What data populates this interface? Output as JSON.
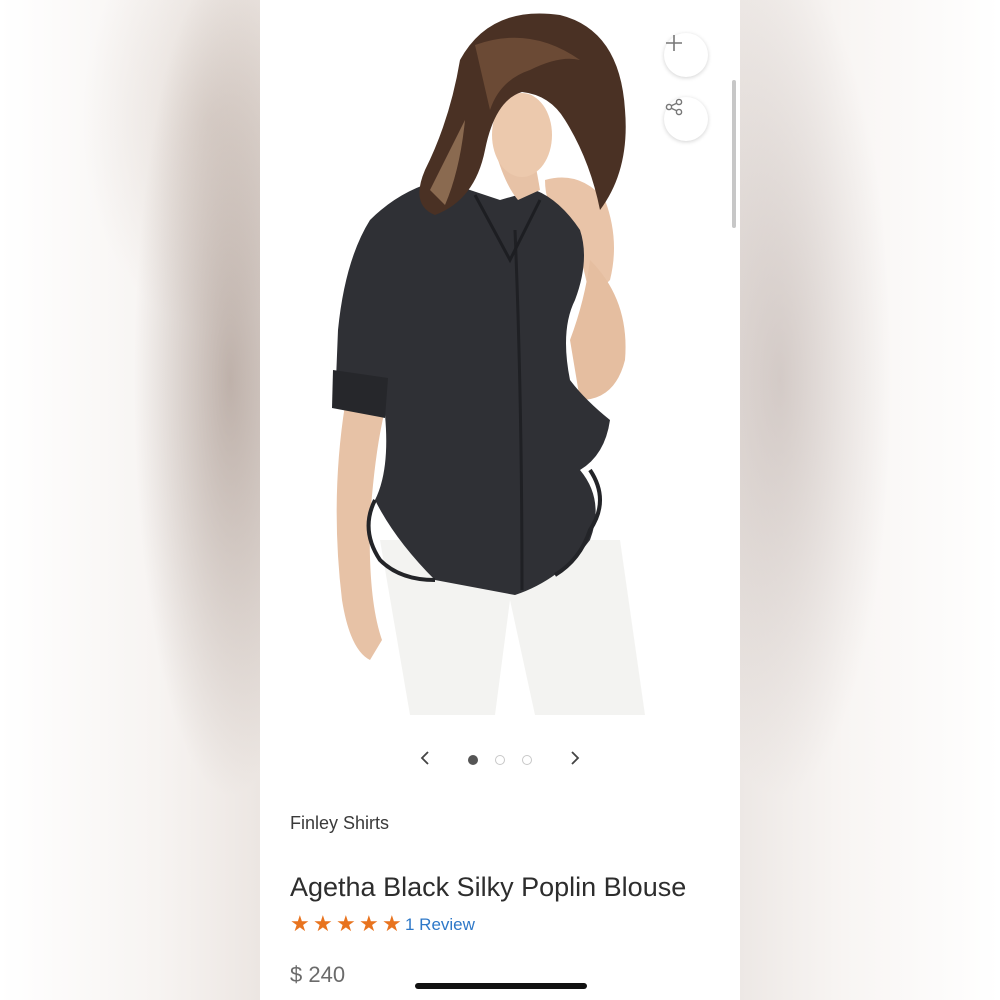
{
  "product": {
    "brand": "Finley Shirts",
    "title": "Agetha Black Silky Poplin Blouse",
    "rating_stars": 5,
    "rating_value": 5,
    "review_text": "1 Review",
    "price": "$ 240"
  },
  "actions": {
    "add_icon": "plus-icon",
    "share_icon": "share-icon"
  },
  "carousel": {
    "total_images": 3,
    "active_index": 0,
    "prev_icon": "chevron-left-icon",
    "next_icon": "chevron-right-icon"
  },
  "colors": {
    "star": "#e8731e",
    "link": "#2e78c8",
    "text": "#2d2d2d",
    "price": "#6b6b6b"
  }
}
